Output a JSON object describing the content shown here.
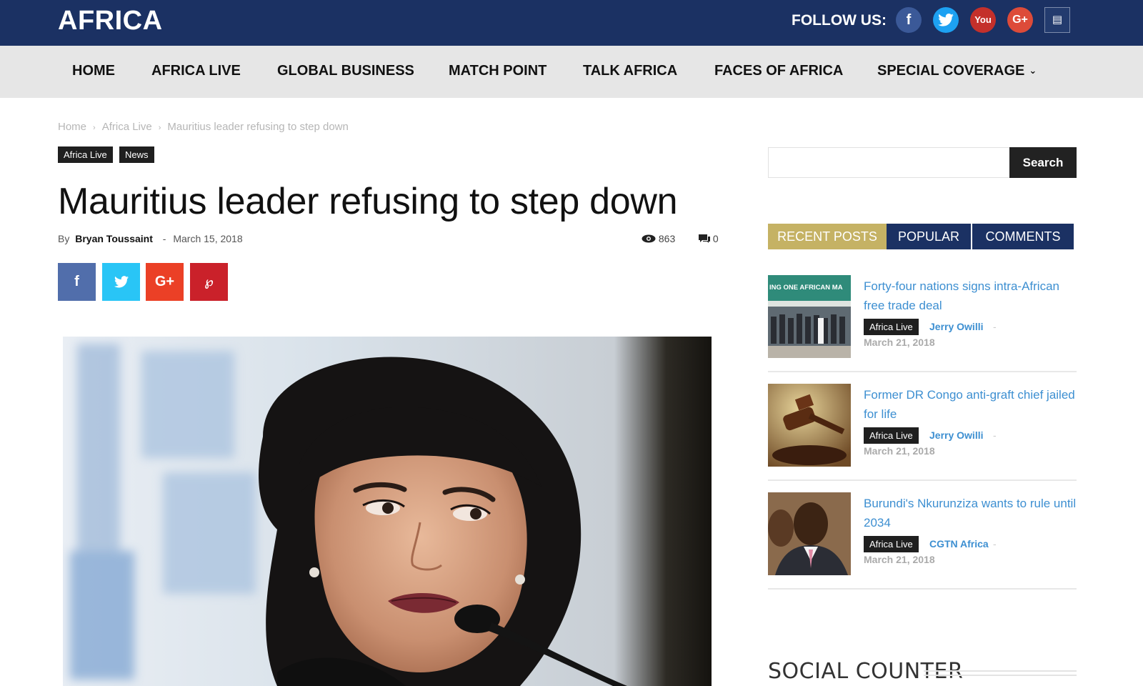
{
  "header": {
    "logo": "AFRICA",
    "follow_label": "FOLLOW US:",
    "social_icons": [
      "facebook-icon",
      "twitter-icon",
      "youtube-icon",
      "google-plus-icon",
      "rss-icon"
    ]
  },
  "nav": {
    "items": [
      "HOME",
      "AFRICA LIVE",
      "GLOBAL BUSINESS",
      "MATCH POINT",
      "TALK AFRICA",
      "FACES OF AFRICA",
      "SPECIAL COVERAGE"
    ]
  },
  "breadcrumb": [
    "Home",
    "Africa Live",
    "Mauritius leader refusing to step down"
  ],
  "article": {
    "tags": [
      "Africa Live",
      "News"
    ],
    "title": "Mauritius leader refusing to step down",
    "by_label": "By",
    "author": "Bryan Toussaint",
    "separator": "-",
    "date": "March 15, 2018",
    "views": "863",
    "comments": "0"
  },
  "share_icons": [
    "facebook-share-icon",
    "twitter-share-icon",
    "google-plus-share-icon",
    "pinterest-share-icon"
  ],
  "sidebar": {
    "search": {
      "placeholder": "",
      "button_label": "Search"
    },
    "tabs": [
      "RECENT POSTS",
      "POPULAR",
      "COMMENTS"
    ],
    "posts": [
      {
        "title": "Forty-four nations signs intra-African free trade deal",
        "category": "Africa Live",
        "author": "Jerry Owilli",
        "date": "March 21, 2018",
        "thumb_text": "ING ONE AFRICAN MA"
      },
      {
        "title": "Former DR Congo anti-graft chief jailed for life",
        "category": "Africa Live",
        "author": "Jerry Owilli",
        "date": "March 21, 2018"
      },
      {
        "title": "Burundi's Nkurunziza wants to rule until 2034",
        "category": "Africa Live",
        "author": "CGTN Africa",
        "date": "March 21, 2018"
      }
    ],
    "social_counter_title": "SOCIAL COUNTER"
  },
  "colors": {
    "header_bg": "#1b3163",
    "nav_bg": "#e6e6e6",
    "tab_active": "#c5b264",
    "tab_inactive": "#1b3163",
    "link": "#3d8fd1"
  }
}
